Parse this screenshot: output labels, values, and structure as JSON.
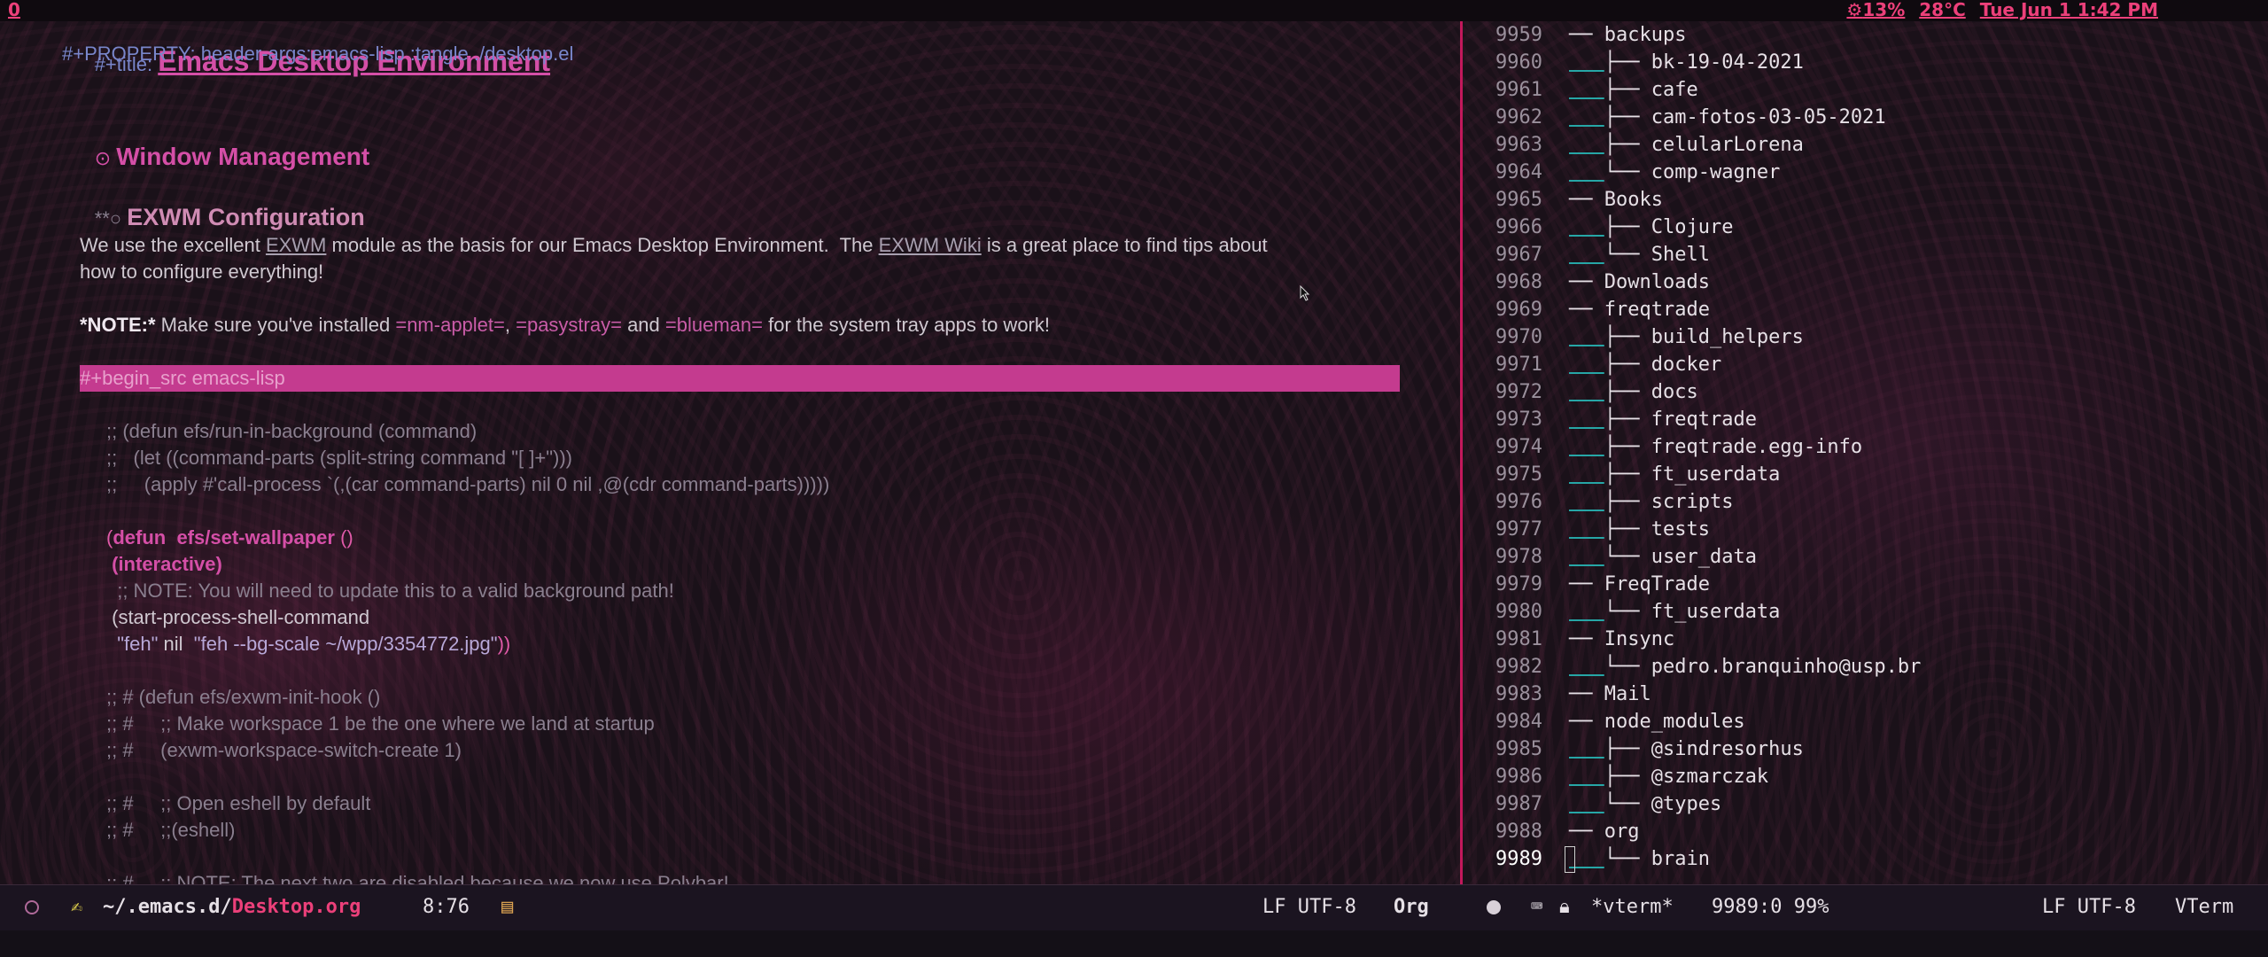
{
  "topbar": {
    "workspace": "0",
    "cpu": "13%",
    "temp": "28°C",
    "datetime": "Tue Jun  1 1:42 PM"
  },
  "org": {
    "title_kw": "#+title:",
    "title": "Emacs Desktop Environment",
    "property": "#+PROPERTY: header-args:emacs-lisp :tangle ./desktop.el",
    "h1_bullet": "⊙",
    "h1": "Window Management",
    "h2_bullet": "**○",
    "h2": "EXWM Configuration",
    "p1_a": "We use the excellent ",
    "p1_link1": "EXWM",
    "p1_b": " module as the basis for our Emacs Desktop Environment.  The ",
    "p1_link2": "EXWM Wiki",
    "p1_c": " is a great place to find tips about",
    "p1_d": "how to configure everything!",
    "note_bold": "*NOTE:*",
    "note_a": " Make sure you've installed ",
    "note_v1": "=nm-applet=",
    "note_b": ", ",
    "note_v2": "=pasystray=",
    "note_c": " and ",
    "note_v3": "=blueman=",
    "note_d": " for the system tray apps to work!",
    "begin_src": "#+begin_src emacs-lisp",
    "code": {
      "c1": ";; (defun efs/run-in-background (command)",
      "c2": ";;   (let ((command-parts (split-string command \"[ ]+\")))",
      "c3": ";;     (apply #'call-process `(,(car command-parts) nil 0 nil ,@(cdr command-parts)))))",
      "d1_open": "(",
      "d1_defun": "defun",
      "d1_name": "  efs/set-wallpaper",
      "d1_args": " ()",
      "d2": " (interactive)",
      "d3": "  ;; NOTE: You will need to update this to a valid background path!",
      "d4": " (start-process-shell-command",
      "d5_a": "  \"feh\"",
      "d5_b": " nil ",
      "d5_c": " \"feh --bg-scale ~/wpp/3354772.jpg\"",
      "d5_d": "))",
      "e1": ";; # (defun efs/exwm-init-hook ()",
      "e2": ";; #     ;; Make workspace 1 be the one where we land at startup",
      "e3": ";; #     (exwm-workspace-switch-create 1)",
      "f1": ";; #     ;; Open eshell by default",
      "f2": ";; #     ;;(eshell)",
      "g1": ";; #     ;; NOTE: The next two are disabled because we now use Polybar!"
    }
  },
  "terminal": {
    "rows": [
      {
        "n": "9959",
        "t": "── backups",
        "bar": false
      },
      {
        "n": "9960",
        "t": "├── bk-19-04-2021",
        "bar": true
      },
      {
        "n": "9961",
        "t": "├── cafe",
        "bar": true
      },
      {
        "n": "9962",
        "t": "├── cam-fotos-03-05-2021",
        "bar": true
      },
      {
        "n": "9963",
        "t": "├── celularLorena",
        "bar": true
      },
      {
        "n": "9964",
        "t": "└── comp-wagner",
        "bar": true
      },
      {
        "n": "9965",
        "t": "── Books",
        "bar": false
      },
      {
        "n": "9966",
        "t": "├── Clojure",
        "bar": true
      },
      {
        "n": "9967",
        "t": "└── Shell",
        "bar": true
      },
      {
        "n": "9968",
        "t": "── Downloads",
        "bar": false
      },
      {
        "n": "9969",
        "t": "── freqtrade",
        "bar": false
      },
      {
        "n": "9970",
        "t": "├── build_helpers",
        "bar": true
      },
      {
        "n": "9971",
        "t": "├── docker",
        "bar": true
      },
      {
        "n": "9972",
        "t": "├── docs",
        "bar": true
      },
      {
        "n": "9973",
        "t": "├── freqtrade",
        "bar": true
      },
      {
        "n": "9974",
        "t": "├── freqtrade.egg-info",
        "bar": true
      },
      {
        "n": "9975",
        "t": "├── ft_userdata",
        "bar": true
      },
      {
        "n": "9976",
        "t": "├── scripts",
        "bar": true
      },
      {
        "n": "9977",
        "t": "├── tests",
        "bar": true
      },
      {
        "n": "9978",
        "t": "└── user_data",
        "bar": true
      },
      {
        "n": "9979",
        "t": "── FreqTrade",
        "bar": false
      },
      {
        "n": "9980",
        "t": "└── ft_userdata",
        "bar": true
      },
      {
        "n": "9981",
        "t": "── Insync",
        "bar": false
      },
      {
        "n": "9982",
        "t": "└── pedro.branquinho@usp.br",
        "bar": true
      },
      {
        "n": "9983",
        "t": "── Mail",
        "bar": false
      },
      {
        "n": "9984",
        "t": "── node_modules",
        "bar": false
      },
      {
        "n": "9985",
        "t": "├── @sindresorhus",
        "bar": true
      },
      {
        "n": "9986",
        "t": "├── @szmarczak",
        "bar": true
      },
      {
        "n": "9987",
        "t": "└── @types",
        "bar": true
      },
      {
        "n": "9988",
        "t": "── org",
        "bar": false
      },
      {
        "n": "9989",
        "t": "└── brain",
        "bar": true,
        "cur": true
      }
    ]
  },
  "modeline_left": {
    "path_prefix": "~/.emacs.d/",
    "filename": "Desktop.org",
    "position": "8:76",
    "encoding": "LF UTF-8",
    "mode": "Org"
  },
  "modeline_right": {
    "buffer": "*vterm*",
    "position": "9989:0 99%",
    "encoding": "LF UTF-8",
    "mode": "VTerm"
  },
  "colors": {
    "accent": "#ec407a",
    "heading": "#d54fa7",
    "src_bar": "#c43b8f",
    "tree_bar": "#26a6a6"
  }
}
